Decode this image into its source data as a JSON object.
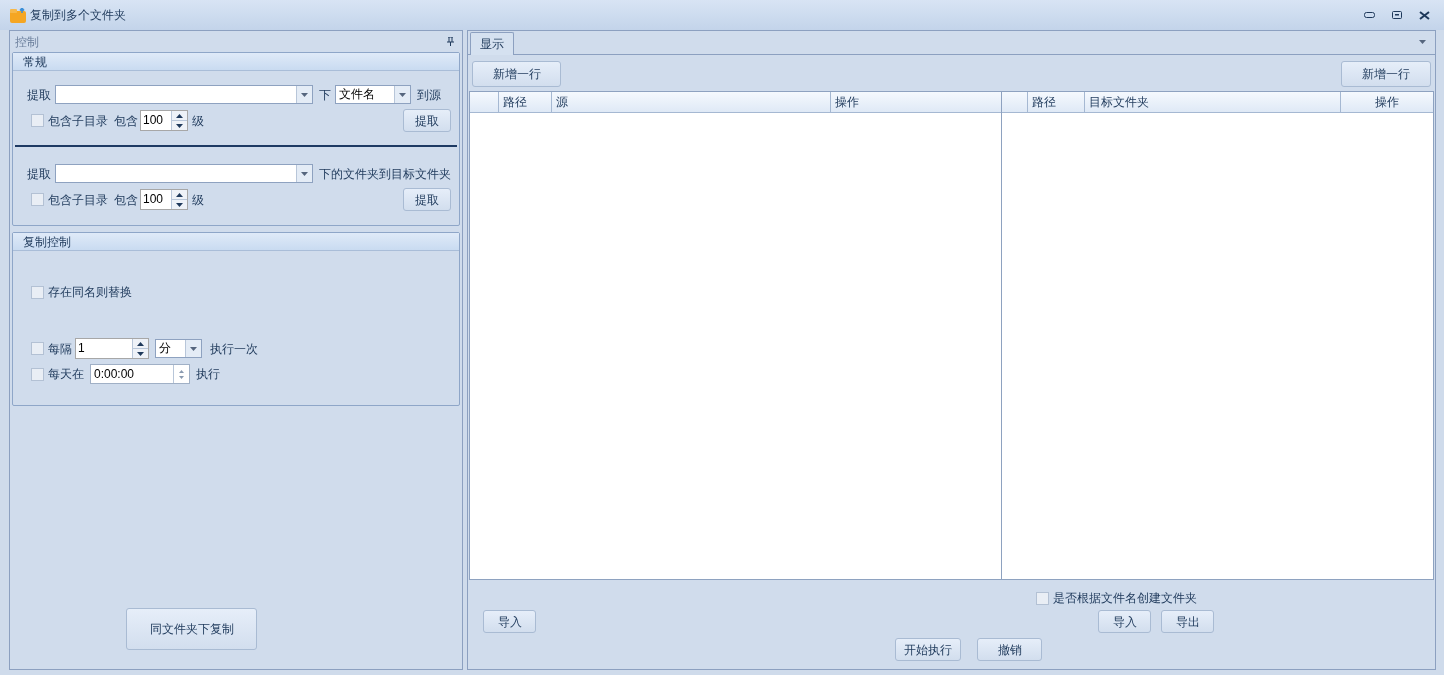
{
  "window": {
    "title": "复制到多个文件夹"
  },
  "control_panel": {
    "title": "控制",
    "general": {
      "title": "常规",
      "source_extract": {
        "label": "提取",
        "between_label": "下",
        "type_select": "文件名",
        "after_label": "到源",
        "include_subdirs": {
          "label": "包含子目录",
          "checked": false
        },
        "depth_label": "包含",
        "depth": "100",
        "unit": "级",
        "button": "提取"
      },
      "target_extract": {
        "label": "提取",
        "after_label": "下的文件夹到目标文件夹",
        "include_subdirs": {
          "label": "包含子目录",
          "checked": false
        },
        "depth_label": "包含",
        "depth": "100",
        "unit": "级",
        "button": "提取"
      }
    },
    "copy_control": {
      "title": "复制控制",
      "replace_existing": {
        "label": "存在同名则替换",
        "checked": false
      },
      "interval": {
        "label": "每隔",
        "checked": false,
        "value": "1",
        "unit": "分",
        "suffix": "执行一次"
      },
      "daily": {
        "label": "每天在",
        "checked": false,
        "time": "0:00:00",
        "suffix": "执行"
      }
    },
    "copy_button": "同文件夹下复制"
  },
  "display": {
    "tabs": [
      {
        "label": "显示",
        "selected": true
      }
    ],
    "add_row_buttons": [
      "新增一行",
      "新增一行"
    ],
    "source_table": {
      "columns": [
        "路径",
        "源",
        "操作"
      ]
    },
    "target_table": {
      "columns": [
        "路径",
        "目标文件夹",
        "操作"
      ]
    },
    "create_by_name": {
      "label": "是否根据文件名创建文件夹",
      "checked": false
    },
    "import_left": "导入",
    "import_right": "导入",
    "export": "导出",
    "start": "开始执行",
    "cancel": "撤销"
  }
}
